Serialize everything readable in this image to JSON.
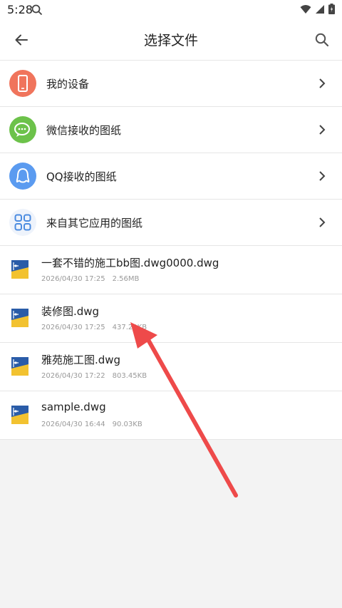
{
  "status_bar": {
    "time": "5:28"
  },
  "header": {
    "title": "选择文件"
  },
  "sources": [
    {
      "label": "我的设备",
      "icon": "phone-icon",
      "color": "#f0745c"
    },
    {
      "label": "微信接收的图纸",
      "icon": "wechat-icon",
      "color": "#6cc24a"
    },
    {
      "label": "QQ接收的图纸",
      "icon": "qq-icon",
      "color": "#5b9bf0"
    },
    {
      "label": "来自其它应用的图纸",
      "icon": "apps-grid-icon",
      "color": "#4a8be0"
    }
  ],
  "files": [
    {
      "name": "一套不错的施工bb图.dwg0000.dwg",
      "date": "2026/04/30 17:25",
      "size": "2.56MB"
    },
    {
      "name": "装修图.dwg",
      "date": "2026/04/30 17:25",
      "size": "437.29KB"
    },
    {
      "name": "雅苑施工图.dwg",
      "date": "2026/04/30 17:22",
      "size": "803.45KB"
    },
    {
      "name": "sample.dwg",
      "date": "2026/04/30 16:44",
      "size": "90.03KB"
    }
  ],
  "colors": {
    "annotation_arrow": "#ee4a4a",
    "file_icon_blue": "#2a5ca8",
    "file_icon_yellow": "#f2c230"
  }
}
